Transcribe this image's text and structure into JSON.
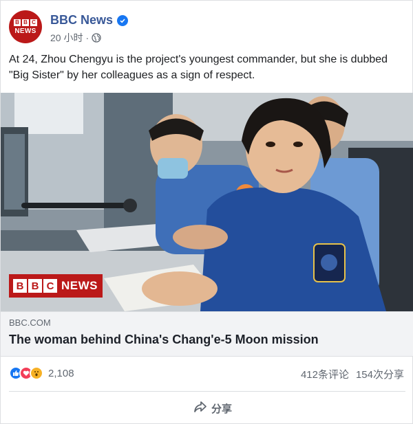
{
  "header": {
    "page_name": "BBC News",
    "time": "20 小时",
    "separator": "·",
    "avatar_letters": [
      "B",
      "B",
      "C"
    ],
    "avatar_word": "NEWS"
  },
  "post": {
    "caption": "At 24, Zhou Chengyu is the project's youngest commander, but she is dubbed \"Big Sister\" by her colleagues as a sign of respect."
  },
  "photo": {
    "badge_letters": [
      "B",
      "B",
      "C"
    ],
    "badge_word": "NEWS"
  },
  "link": {
    "domain": "BBC.COM",
    "title": "The woman behind China's Chang'e-5 Moon mission"
  },
  "reactions": {
    "count": "2,108",
    "comments": "412条评论",
    "shares": "154次分享",
    "icons": [
      "like-icon",
      "love-icon",
      "wow-icon"
    ]
  },
  "actions": {
    "share_label": "分享"
  },
  "colors": {
    "page_name": "#385898",
    "bbc_red": "#bb1919",
    "verified": "#1877f2",
    "meta_text": "#606770"
  }
}
